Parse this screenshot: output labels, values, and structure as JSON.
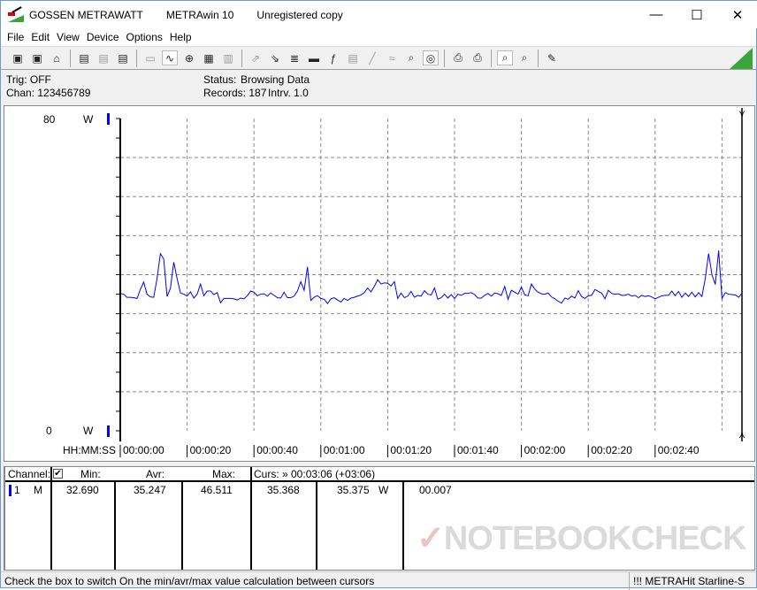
{
  "window": {
    "brand": "GOSSEN METRAWATT",
    "app": "METRAwin 10",
    "license": "Unregistered copy",
    "controls": {
      "minimize": "—",
      "maximize": "☐",
      "close": "✕"
    }
  },
  "menu": [
    "File",
    "Edit",
    "View",
    "Device",
    "Options",
    "Help"
  ],
  "toolbar": [
    {
      "icon": "save-icon",
      "glyph": "▣"
    },
    {
      "icon": "save-as-icon",
      "glyph": "▣"
    },
    {
      "icon": "open-folder-icon",
      "glyph": "⌂"
    },
    {
      "sep": true
    },
    {
      "icon": "device-read-icon",
      "glyph": "▤"
    },
    {
      "icon": "device-transfer-icon",
      "glyph": "▤",
      "disabled": true
    },
    {
      "icon": "memory-icon",
      "glyph": "▤"
    },
    {
      "sep": true
    },
    {
      "icon": "display-icon",
      "glyph": "▭",
      "disabled": true
    },
    {
      "icon": "line-chart-icon",
      "glyph": "∿",
      "active": true
    },
    {
      "icon": "crosshair-icon",
      "glyph": "⊕"
    },
    {
      "icon": "table-icon",
      "glyph": "▦"
    },
    {
      "icon": "bar-list-icon",
      "glyph": "▥",
      "disabled": true
    },
    {
      "sep": true
    },
    {
      "icon": "export-icon",
      "glyph": "⇗",
      "disabled": true
    },
    {
      "icon": "import-icon",
      "glyph": "⇘"
    },
    {
      "icon": "data-list-icon",
      "glyph": "≣"
    },
    {
      "icon": "monitor-icon",
      "glyph": "▬"
    },
    {
      "icon": "function-icon",
      "glyph": "ƒ"
    },
    {
      "icon": "device-icon",
      "glyph": "▤",
      "disabled": true
    },
    {
      "icon": "signal-icon",
      "glyph": "╱",
      "disabled": true
    },
    {
      "icon": "wave-icon",
      "glyph": "≈",
      "disabled": true
    },
    {
      "icon": "zoom-wave-icon",
      "glyph": "⌕"
    },
    {
      "icon": "trigger-icon",
      "glyph": "◎",
      "active": true
    },
    {
      "sep": true
    },
    {
      "icon": "print-icon",
      "glyph": "⎙"
    },
    {
      "icon": "print-preview-icon",
      "glyph": "⎙"
    },
    {
      "sep": true
    },
    {
      "icon": "zoom-in-icon",
      "glyph": "⌕",
      "active": true
    },
    {
      "icon": "zoom-out-icon",
      "glyph": "⌕"
    },
    {
      "sep": true
    },
    {
      "icon": "comment-icon",
      "glyph": "✎"
    }
  ],
  "info": {
    "trig": "Trig: OFF",
    "chan": "Chan:  123456789",
    "status_label": "Status:",
    "status_value": "Browsing Data",
    "records": "Records: 187",
    "interval": "Intrv. 1.0"
  },
  "chart_data": {
    "type": "line",
    "ylim": [
      0,
      80
    ],
    "y_ticks": [
      "80",
      "0"
    ],
    "y_unit": "W",
    "xlabel": "HH:MM:SS",
    "x_ticks": [
      "00:00:00",
      "00:00:20",
      "00:00:40",
      "00:01:00",
      "00:01:20",
      "00:01:40",
      "00:02:00",
      "00:02:20",
      "00:02:40"
    ],
    "x_range_seconds": [
      0,
      186
    ],
    "grid": true,
    "series_color": "#0000ff",
    "values": [
      35.2,
      35.0,
      34.2,
      34.2,
      34.1,
      33.9,
      36.2,
      38.1,
      35.0,
      34.3,
      34.2,
      39.0,
      45.4,
      44.0,
      34.4,
      36.5,
      43.2,
      39.0,
      35.3,
      35.0,
      34.5,
      35.6,
      34.0,
      35.0,
      37.6,
      34.6,
      35.8,
      35.8,
      34.9,
      35.4,
      32.8,
      33.9,
      33.9,
      33.9,
      33.8,
      33.5,
      34.0,
      33.8,
      34.6,
      35.8,
      35.5,
      34.6,
      35.0,
      35.1,
      34.5,
      35.3,
      34.7,
      34.1,
      34.0,
      35.5,
      34.1,
      34.1,
      34.5,
      35.8,
      38.2,
      36.0,
      42.0,
      33.4,
      34.2,
      34.6,
      33.9,
      33.7,
      32.6,
      33.8,
      34.1,
      33.5,
      33.0,
      33.9,
      33.4,
      34.0,
      34.2,
      34.5,
      34.8,
      35.4,
      36.6,
      35.6,
      37.0,
      38.7,
      37.6,
      37.9,
      37.8,
      37.1,
      38.2,
      33.9,
      35.3,
      34.1,
      34.5,
      35.7,
      34.2,
      34.7,
      34.5,
      35.9,
      35.0,
      34.8,
      36.6,
      33.7,
      34.1,
      35.0,
      34.0,
      34.9,
      33.9,
      35.0,
      34.7,
      35.2,
      35.2,
      35.4,
      34.9,
      34.0,
      34.0,
      34.7,
      35.2,
      34.5,
      35.3,
      35.1,
      34.7,
      37.0,
      33.7,
      36.0,
      35.5,
      35.0,
      36.8,
      34.8,
      34.6,
      37.6,
      36.3,
      35.5,
      35.1,
      35.0,
      35.3,
      34.3,
      33.8,
      33.2,
      32.7,
      34.0,
      33.7,
      34.5,
      34.0,
      35.9,
      34.4,
      33.9,
      34.6,
      34.7,
      36.2,
      35.7,
      35.3,
      33.8,
      36.0,
      35.2,
      35.0,
      35.1,
      34.7,
      34.7,
      35.0,
      34.5,
      34.7,
      34.1,
      34.7,
      34.4,
      34.6,
      34.3,
      33.8,
      34.2,
      34.6,
      34.7,
      34.7,
      35.8,
      34.6,
      35.7,
      34.2,
      35.3,
      34.4,
      35.5,
      34.3,
      35.4,
      34.4,
      39.0,
      45.4,
      40.0,
      37.5,
      46.2,
      33.9,
      35.4,
      35.0,
      34.9,
      34.8,
      34.2,
      35.2
    ]
  },
  "table": {
    "headers": {
      "channel": "Channel:",
      "min": "Min:",
      "avr": "Avr:",
      "max": "Max:",
      "cursor": "Curs: » 00:03:06 (+03:06)"
    },
    "checkbox_checked": true,
    "row": {
      "num": "1",
      "mode": "M",
      "min": "32.690",
      "avr": "35.247",
      "max": "46.511",
      "cur1": "35.368",
      "cur2": "35.375",
      "unit": "W",
      "delta": "00.007"
    }
  },
  "status": {
    "hint": "Check the box to switch On the min/avr/max value calculation between cursors",
    "device": "!!! METRAHit Starline-S"
  },
  "watermark": "NOTEBOOKCHECK"
}
